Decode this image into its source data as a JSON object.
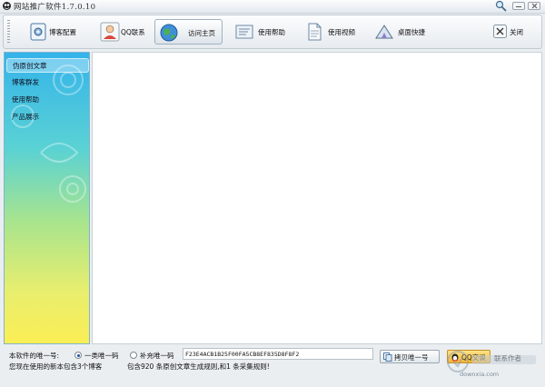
{
  "window": {
    "title": "网站推广软件1.7.0.10"
  },
  "toolbar": {
    "items": [
      {
        "label": "博客配置",
        "icon": "gear-icon"
      },
      {
        "label": "QQ联系",
        "icon": "user-icon"
      },
      {
        "label": "访问主页",
        "icon": "globe-icon"
      },
      {
        "label": "使用帮助",
        "icon": "help-icon"
      },
      {
        "label": "使用视频",
        "icon": "video-icon"
      },
      {
        "label": "桌面快捷",
        "icon": "shortcut-icon"
      },
      {
        "label": "关闭",
        "icon": "close-icon"
      }
    ],
    "active_index": 2
  },
  "sidebar": {
    "items": [
      {
        "label": "伪原创文章"
      },
      {
        "label": "博客群发"
      },
      {
        "label": "使用帮助"
      },
      {
        "label": "产品展示"
      }
    ],
    "selected_index": 0
  },
  "status": {
    "unique_id_label": "本软件的唯一号:",
    "radio_primary": "一类唯一码",
    "radio_secondary": "补充唯一码",
    "unique_id_value": "F23E4ACB1B25F00FA5CB8EF835D8F8F2",
    "copy_button": "拷贝唯一号",
    "qq_button": "QQ交谈",
    "contact_author": "联系作者",
    "blog_count_text": "您现在使用的新本包含3个博客",
    "rules_text": "包含920 条原创文章生成规则,和1 条采集规则!"
  },
  "watermark": {
    "text": "downxia.com"
  },
  "colors": {
    "sidebar_top": "#34b3ea",
    "sidebar_bottom": "#fbee55",
    "qq_button": "#f5b52e"
  }
}
